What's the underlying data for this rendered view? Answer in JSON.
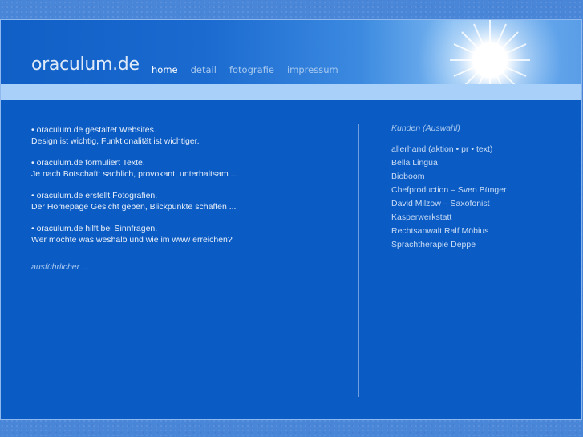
{
  "logo": "oraculum.de",
  "nav": [
    {
      "label": "home",
      "active": true
    },
    {
      "label": "detail",
      "active": false
    },
    {
      "label": "fotografie",
      "active": false
    },
    {
      "label": "impressum",
      "active": false
    }
  ],
  "intro": [
    {
      "line1": "• oraculum.de gestaltet Websites.",
      "line2": "Design ist wichtig, Funktionalität ist wichtiger."
    },
    {
      "line1": "• oraculum.de formuliert Texte.",
      "line2": "Je nach Botschaft: sachlich, provokant, unterhaltsam ..."
    },
    {
      "line1": "• oraculum.de erstellt Fotografien.",
      "line2": "Der Homepage Gesicht geben, Blickpunkte schaffen ..."
    },
    {
      "line1": "• oraculum.de hilft bei Sinnfragen.",
      "line2": "Wer möchte was weshalb und wie im www erreichen?"
    }
  ],
  "more_link": "ausführlicher ...",
  "clients": {
    "heading": "Kunden (Auswahl)",
    "items": [
      "allerhand (aktion • pr • text)",
      "Bella Lingua",
      "Bioboom",
      "Chefproduction – Sven Bünger",
      "David Milzow – Saxofonist",
      "Kasperwerkstatt",
      "Rechtsanwalt Ralf Möbius",
      "Sprachtherapie Deppe"
    ]
  },
  "colors": {
    "page_bg": "#4a86d8",
    "content_bg": "#0a5bc4",
    "band": "#a9d0f8",
    "accent_text": "#a9c9ef"
  }
}
